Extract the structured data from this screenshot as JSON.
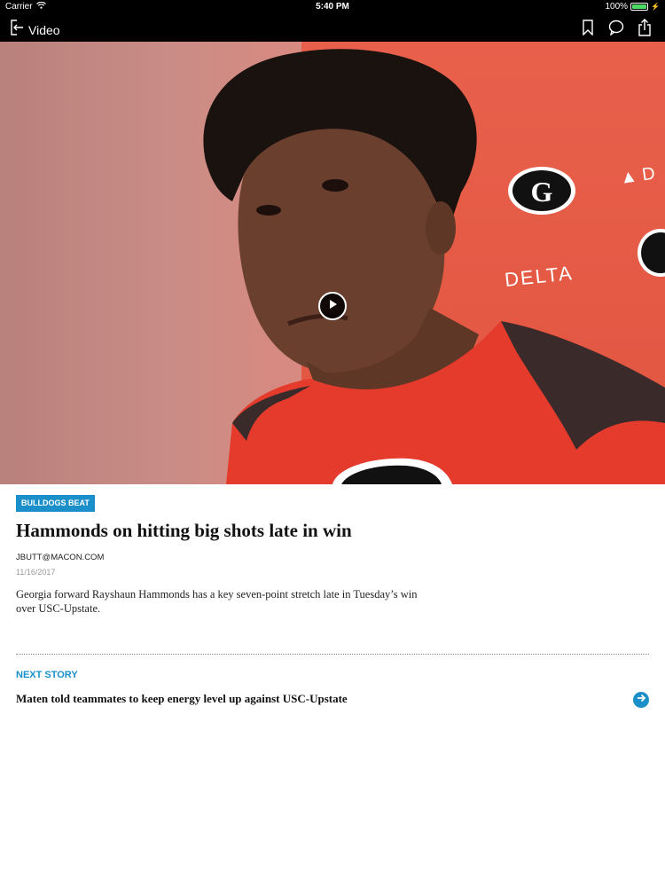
{
  "status_bar": {
    "carrier": "Carrier",
    "time": "5:40 PM",
    "battery_percent": "100%",
    "battery_level": 1.0
  },
  "nav": {
    "back_label": "Video",
    "icons": [
      "exit-icon",
      "bookmark-icon",
      "comment-icon",
      "share-icon"
    ]
  },
  "video": {
    "play_icon": "play-icon"
  },
  "article": {
    "category": "BULLDOGS BEAT",
    "headline": "Hammonds on hitting big shots late in win",
    "byline": "JBUTT@MACON.COM",
    "date": "11/16/2017",
    "summary": "Georgia forward Rayshaun Hammonds has a key seven-point stretch late in Tuesday’s win over USC-Upstate."
  },
  "next_story": {
    "label": "NEXT STORY",
    "title": "Maten told teammates to keep energy level up against USC-Upstate",
    "icon": "arrow-right-icon"
  },
  "colors": {
    "accent": "#1a8fc9",
    "bar": "#000000",
    "jersey_red": "#e53b2d"
  }
}
